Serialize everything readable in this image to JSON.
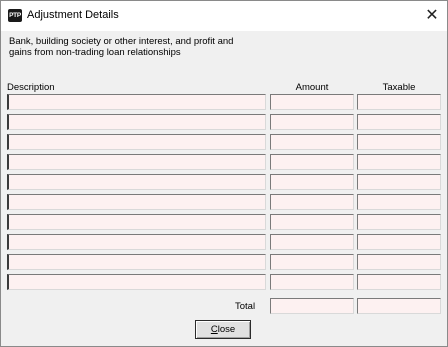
{
  "window": {
    "title": "Adjustment Details",
    "icon_text": "PTP",
    "close_glyph": "✕"
  },
  "description": {
    "line1": "Bank, building society or other interest, and profit and",
    "line2": "gains from non-trading loan relationships"
  },
  "table": {
    "headers": {
      "description": "Description",
      "amount": "Amount",
      "taxable": "Taxable"
    },
    "rows": [
      {
        "description": "",
        "amount": "",
        "taxable": ""
      },
      {
        "description": "",
        "amount": "",
        "taxable": ""
      },
      {
        "description": "",
        "amount": "",
        "taxable": ""
      },
      {
        "description": "",
        "amount": "",
        "taxable": ""
      },
      {
        "description": "",
        "amount": "",
        "taxable": ""
      },
      {
        "description": "",
        "amount": "",
        "taxable": ""
      },
      {
        "description": "",
        "amount": "",
        "taxable": ""
      },
      {
        "description": "",
        "amount": "",
        "taxable": ""
      },
      {
        "description": "",
        "amount": "",
        "taxable": ""
      },
      {
        "description": "",
        "amount": "",
        "taxable": ""
      }
    ],
    "total_label": "Total",
    "total_amount": "",
    "total_taxable": ""
  },
  "buttons": {
    "close_mnemonic": "C",
    "close_rest": "lose"
  }
}
